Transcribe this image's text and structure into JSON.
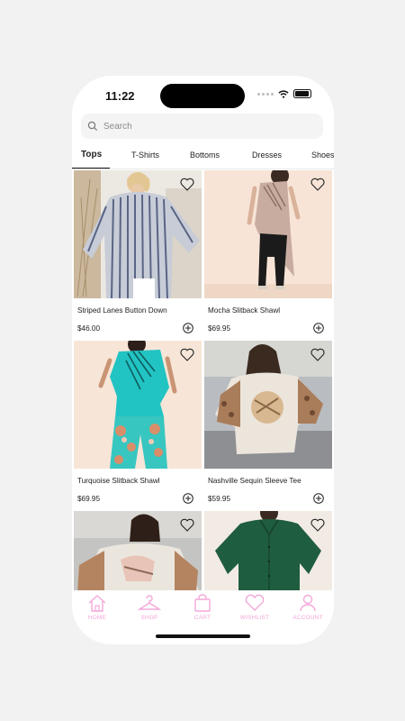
{
  "status_bar": {
    "time": "11:22"
  },
  "search": {
    "placeholder": "Search",
    "icon": "search-icon"
  },
  "tabs": [
    {
      "label": "Tops",
      "active": true
    },
    {
      "label": "T-Shirts",
      "active": false
    },
    {
      "label": "Bottoms",
      "active": false
    },
    {
      "label": "Dresses",
      "active": false
    },
    {
      "label": "Shoes",
      "active": false
    }
  ],
  "products": [
    {
      "name": "Striped Lanes Button Down",
      "price": "$46.00"
    },
    {
      "name": "Mocha Slitback Shawl",
      "price": "$69.95"
    },
    {
      "name": "Turquoise Slitback Shawl",
      "price": "$69.95"
    },
    {
      "name": "Nashville Sequin Sleeve Tee",
      "price": "$59.95"
    },
    {
      "name": "",
      "price": ""
    },
    {
      "name": "",
      "price": ""
    }
  ],
  "tab_bar": {
    "accent_color": "#f3a7d8",
    "items": [
      {
        "label": "HOME",
        "icon": "home-icon"
      },
      {
        "label": "SHOP",
        "icon": "hanger-icon"
      },
      {
        "label": "CART",
        "icon": "shopping-bag-icon"
      },
      {
        "label": "WISHLIST",
        "icon": "heart-icon"
      },
      {
        "label": "ACCOUNT",
        "icon": "person-icon"
      }
    ]
  }
}
